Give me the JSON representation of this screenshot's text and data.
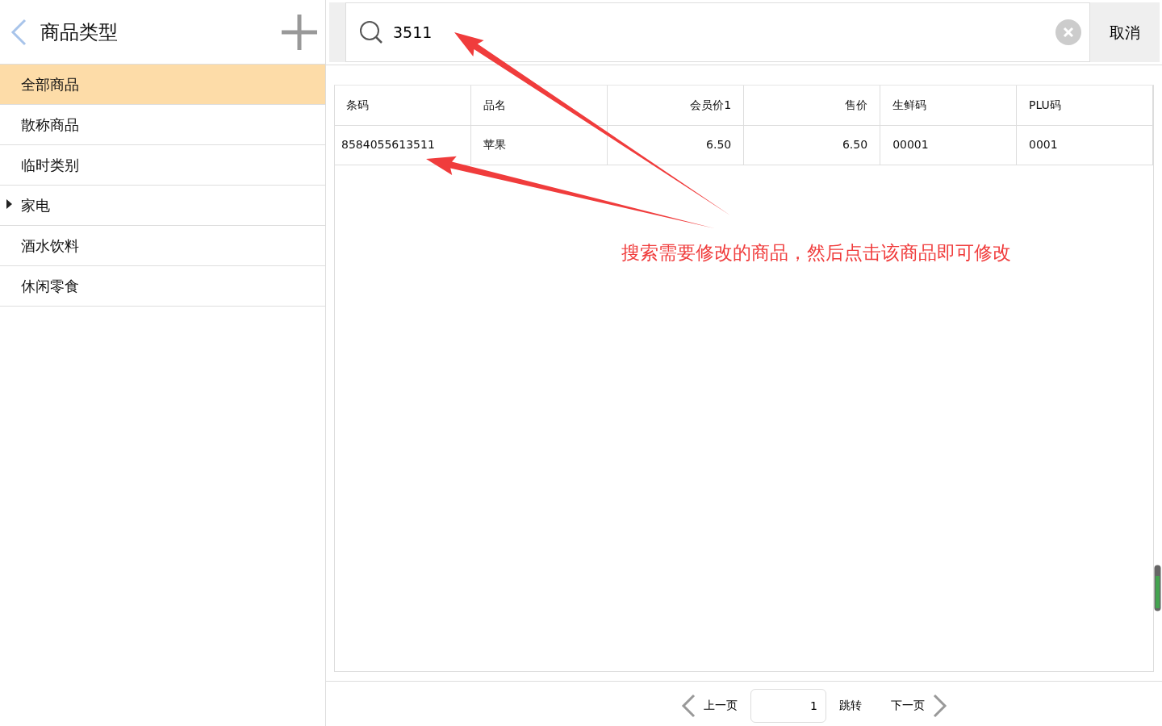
{
  "sidebar": {
    "title": "商品类型",
    "items": [
      {
        "label": "全部商品",
        "selected": true,
        "expandable": false
      },
      {
        "label": "散称商品",
        "selected": false,
        "expandable": false
      },
      {
        "label": "临时类别",
        "selected": false,
        "expandable": false
      },
      {
        "label": "家电",
        "selected": false,
        "expandable": true
      },
      {
        "label": "酒水饮料",
        "selected": false,
        "expandable": false
      },
      {
        "label": "休闲零食",
        "selected": false,
        "expandable": false
      }
    ]
  },
  "search": {
    "value": "3511",
    "cancel": "取消"
  },
  "table": {
    "columns": [
      {
        "label": "条码",
        "kind": "text"
      },
      {
        "label": "品名",
        "kind": "text"
      },
      {
        "label": "会员价1",
        "kind": "number"
      },
      {
        "label": "售价",
        "kind": "number"
      },
      {
        "label": "生鲜码",
        "kind": "text"
      },
      {
        "label": "PLU码",
        "kind": "text"
      }
    ],
    "rows": [
      [
        "8584055613511",
        "苹果",
        "6.50",
        "6.50",
        "00001",
        "0001"
      ]
    ]
  },
  "pagination": {
    "prev": "上一页",
    "page": "1",
    "jump": "跳转",
    "next": "下一页"
  },
  "annotation": "搜索需要修改的商品，然后点击该商品即可修改"
}
